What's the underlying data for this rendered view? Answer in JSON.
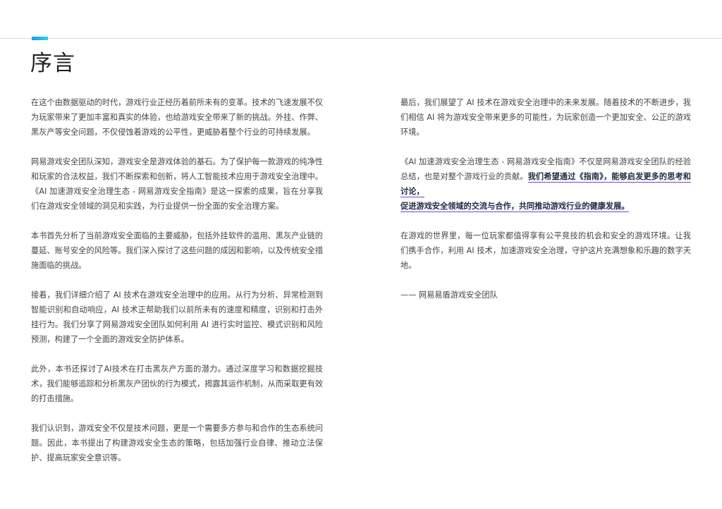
{
  "header": {
    "title": "序言"
  },
  "left_column": {
    "paragraphs": [
      "在这个由数据驱动的时代，游戏行业正经历着前所未有的变革。技术的飞速发展不仅为玩家带来了更加丰富和真实的体验，也给游戏安全带来了新的挑战。外挂、作弊、黑灰产等安全问题，不仅侵蚀着游戏的公平性，更威胁着整个行业的可持续发展。",
      "网易游戏安全团队深知，游戏安全是游戏体验的基石。为了保护每一款游戏的纯净性和玩家的合法权益，我们不断探索和创新，将人工智能技术应用于游戏安全治理中。《AI 加速游戏安全治理生态 - 网易游戏安全指南》是这一探索的成果，旨在分享我们在游戏安全领域的洞见和实践，为行业提供一份全面的安全治理方案。",
      "本书首先分析了当前游戏安全面临的主要威胁，包括外挂软件的滥用、黑灰产业链的蔓延、账号安全的风险等。我们深入探讨了这些问题的成因和影响，以及传统安全措施面临的挑战。",
      "接着，我们详细介绍了 AI 技术在游戏安全治理中的应用。从行为分析、异常检测到智能识别和自动响应，AI 技术正帮助我们以前所未有的速度和精度，识别和打击外挂行为。我们分享了网易游戏安全团队如何利用 AI 进行实时监控、模式识别和风险预测，构建了一个全面的游戏安全防护体系。",
      "此外，本书还探讨了AI技术在打击黑灰产方面的潜力。通过深度学习和数据挖掘技术，我们能够追踪和分析黑灰产团伙的行为模式，揭露其运作机制，从而采取更有效的打击措施。",
      "我们认识到，游戏安全不仅是技术问题，更是一个需要多方参与和合作的生态系统问题。因此，本书提出了构建游戏安全生态的策略，包括加强行业自律、推动立法保护、提高玩家安全意识等。"
    ]
  },
  "right_column": {
    "p1": "最后，我们展望了 AI 技术在游戏安全治理中的未来发展。随着技术的不断进步，我们相信 AI 将为游戏安全带来更多的可能性，为玩家创造一个更加安全、公正的游戏环境。",
    "p2_lead": "《AI 加速游戏安全治理生态 - 网易游戏安全指南》不仅是网易游戏安全团队的经验总结，也是对整个游戏行业的贡献。",
    "p2_emph_1": "我们希望通过《指南》，能够启发更多的思考和讨论，",
    "p2_emph_2": "促进游戏安全领域的交流与合作，共同推动游戏行业的健康发展。",
    "p3": "在游戏的世界里，每一位玩家都值得享有公平竞技的机会和安全的游戏环境。让我们携手合作，利用 AI 技术，加速游戏安全治理，守护这片充满想象和乐趣的数字天地。",
    "signature": "—— 网易易盾游戏安全团队"
  },
  "colors": {
    "accent_start": "#1e9be8",
    "accent_end": "#26d0e8",
    "emphasis_underline": "#7a3fd8"
  }
}
